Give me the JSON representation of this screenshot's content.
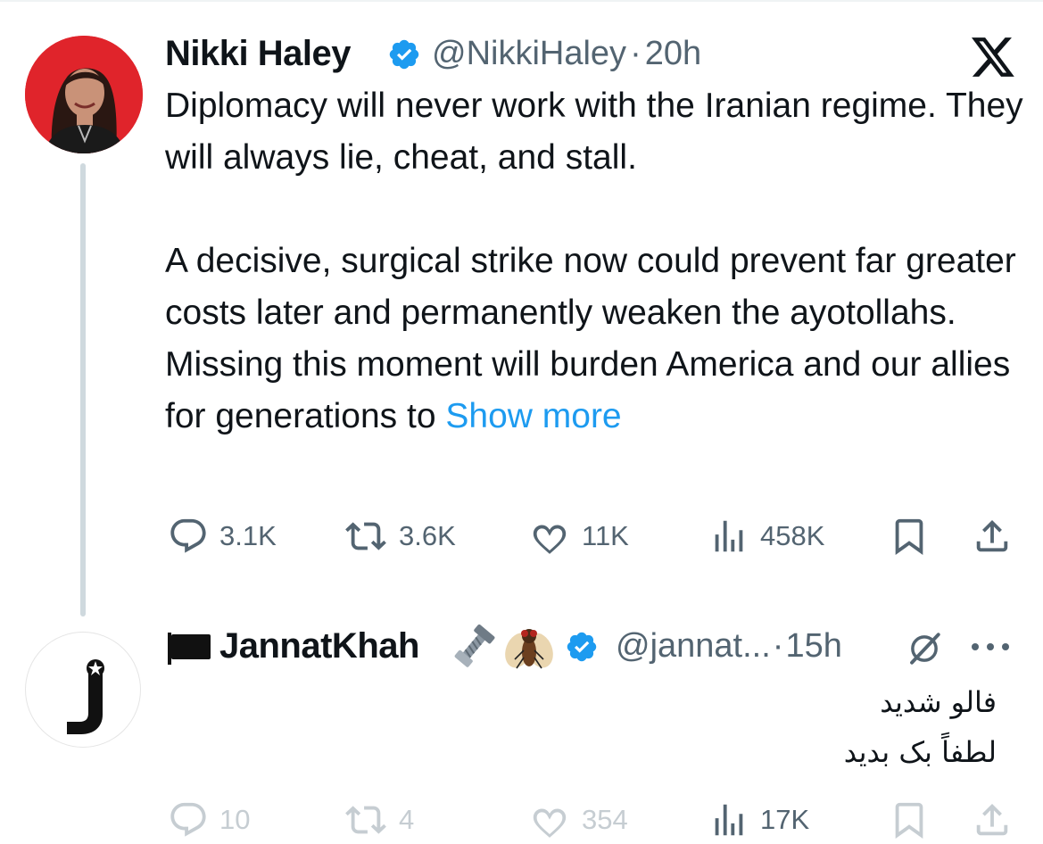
{
  "tweet": {
    "author": {
      "name": "Nikki Haley",
      "handle": "@NikkiHaley",
      "separator": "·",
      "time": "20h",
      "verified": true,
      "avatar_bg": "#e0242b"
    },
    "text": {
      "para1": "Diplomacy will never work with the Iranian regime. They will always lie, cheat, and stall.",
      "para2": "A decisive, surgical strike now could prevent far greater costs later and permanently weaken the ayotollahs. Missing this moment will burden America and our allies for generations to ",
      "show_more": "Show more"
    },
    "stats": {
      "replies": "3.1K",
      "reposts": "3.6K",
      "likes": "11K",
      "views": "458K"
    },
    "platform_icon": "x-logo-icon"
  },
  "reply": {
    "author": {
      "name": "JannatKhah",
      "handle": "@jannat...",
      "separator": "·",
      "time": "15h",
      "verified": true,
      "badges": [
        "black-flag-icon",
        "nut-and-bolt-icon",
        "fly-icon"
      ],
      "avatar_letter": "J"
    },
    "text": {
      "line1": "فالو شدید",
      "line2": "لطفاً بک بدید"
    },
    "stats": {
      "replies": "10",
      "reposts": "4",
      "likes": "354",
      "views": "17K"
    }
  },
  "colors": {
    "accent": "#1d9bf0",
    "text": "#0f1419",
    "secondary": "#536471",
    "thread_line": "#cfd9de",
    "faded": "#c6cdd2"
  }
}
